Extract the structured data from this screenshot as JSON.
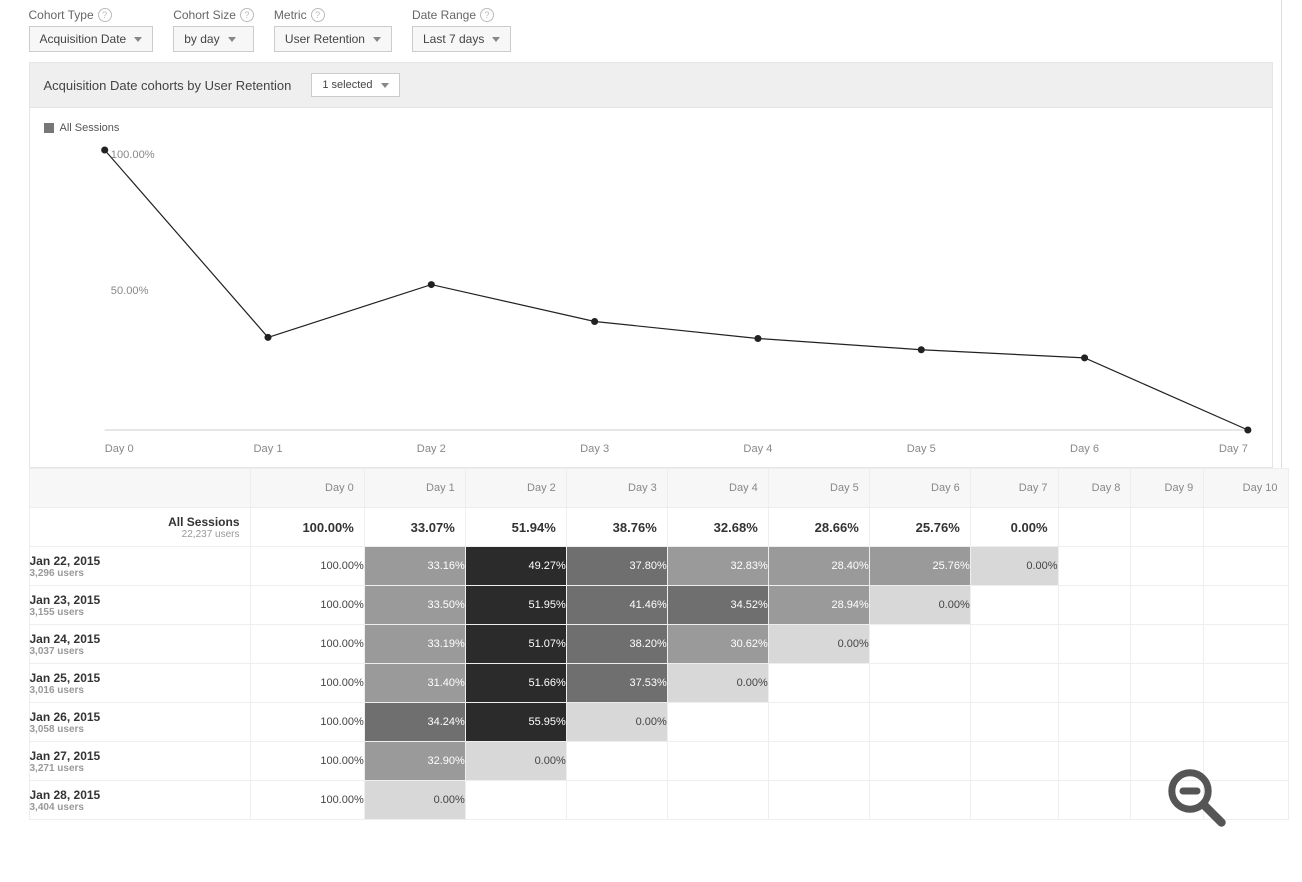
{
  "controls": {
    "cohort_type": {
      "label": "Cohort Type",
      "value": "Acquisition Date"
    },
    "cohort_size": {
      "label": "Cohort Size",
      "value": "by day"
    },
    "metric": {
      "label": "Metric",
      "value": "User Retention"
    },
    "date_range": {
      "label": "Date Range",
      "value": "Last 7 days"
    }
  },
  "panel": {
    "title": "Acquisition Date cohorts by User Retention",
    "selected_label": "1 selected"
  },
  "legend": {
    "name": "All Sessions"
  },
  "chart_data": {
    "type": "line",
    "title": "",
    "xlabel": "",
    "ylabel": "",
    "ylim": [
      0,
      100
    ],
    "yticks": [
      "100.00%",
      "50.00%"
    ],
    "categories": [
      "Day 0",
      "Day 1",
      "Day 2",
      "Day 3",
      "Day 4",
      "Day 5",
      "Day 6",
      "Day 7"
    ],
    "series": [
      {
        "name": "All Sessions",
        "values": [
          100.0,
          33.07,
          51.94,
          38.76,
          32.68,
          28.66,
          25.76,
          0.0
        ]
      }
    ]
  },
  "table": {
    "columns": [
      "Day 0",
      "Day 1",
      "Day 2",
      "Day 3",
      "Day 4",
      "Day 5",
      "Day 6",
      "Day 7",
      "Day 8",
      "Day 9",
      "Day 10"
    ],
    "summary": {
      "title": "All Sessions",
      "sub": "22,237 users",
      "values": [
        "100.00%",
        "33.07%",
        "51.94%",
        "38.76%",
        "32.68%",
        "28.66%",
        "25.76%",
        "0.00%",
        "",
        "",
        ""
      ]
    },
    "rows": [
      {
        "title": "Jan 22, 2015",
        "sub": "3,296 users",
        "values": [
          "100.00%",
          "33.16%",
          "49.27%",
          "37.80%",
          "32.83%",
          "28.40%",
          "25.76%",
          "0.00%",
          "",
          "",
          ""
        ],
        "shade": [
          0,
          3,
          5,
          4,
          3,
          3,
          3,
          1,
          0,
          0,
          0
        ]
      },
      {
        "title": "Jan 23, 2015",
        "sub": "3,155 users",
        "values": [
          "100.00%",
          "33.50%",
          "51.95%",
          "41.46%",
          "34.52%",
          "28.94%",
          "0.00%",
          "",
          "",
          "",
          ""
        ],
        "shade": [
          0,
          3,
          5,
          4,
          4,
          3,
          1,
          0,
          0,
          0,
          0
        ]
      },
      {
        "title": "Jan 24, 2015",
        "sub": "3,037 users",
        "values": [
          "100.00%",
          "33.19%",
          "51.07%",
          "38.20%",
          "30.62%",
          "0.00%",
          "",
          "",
          "",
          "",
          ""
        ],
        "shade": [
          0,
          3,
          5,
          4,
          3,
          1,
          0,
          0,
          0,
          0,
          0
        ]
      },
      {
        "title": "Jan 25, 2015",
        "sub": "3,016 users",
        "values": [
          "100.00%",
          "31.40%",
          "51.66%",
          "37.53%",
          "0.00%",
          "",
          "",
          "",
          "",
          "",
          ""
        ],
        "shade": [
          0,
          3,
          5,
          4,
          1,
          0,
          0,
          0,
          0,
          0,
          0
        ]
      },
      {
        "title": "Jan 26, 2015",
        "sub": "3,058 users",
        "values": [
          "100.00%",
          "34.24%",
          "55.95%",
          "0.00%",
          "",
          "",
          "",
          "",
          "",
          "",
          ""
        ],
        "shade": [
          0,
          4,
          5,
          1,
          0,
          0,
          0,
          0,
          0,
          0,
          0
        ]
      },
      {
        "title": "Jan 27, 2015",
        "sub": "3,271 users",
        "values": [
          "100.00%",
          "32.90%",
          "0.00%",
          "",
          "",
          "",
          "",
          "",
          "",
          "",
          ""
        ],
        "shade": [
          0,
          3,
          1,
          0,
          0,
          0,
          0,
          0,
          0,
          0,
          0
        ]
      },
      {
        "title": "Jan 28, 2015",
        "sub": "3,404 users",
        "values": [
          "100.00%",
          "0.00%",
          "",
          "",
          "",
          "",
          "",
          "",
          "",
          "",
          ""
        ],
        "shade": [
          0,
          1,
          0,
          0,
          0,
          0,
          0,
          0,
          0,
          0,
          0
        ]
      }
    ]
  },
  "shade_colors": [
    "#ffffff",
    "#d8d8d8",
    "#bfbfbf",
    "#9a9a9a",
    "#6f6f6f",
    "#2b2b2b"
  ],
  "shade_text": [
    "#444",
    "#444",
    "#444",
    "#fff",
    "#fff",
    "#fff"
  ]
}
